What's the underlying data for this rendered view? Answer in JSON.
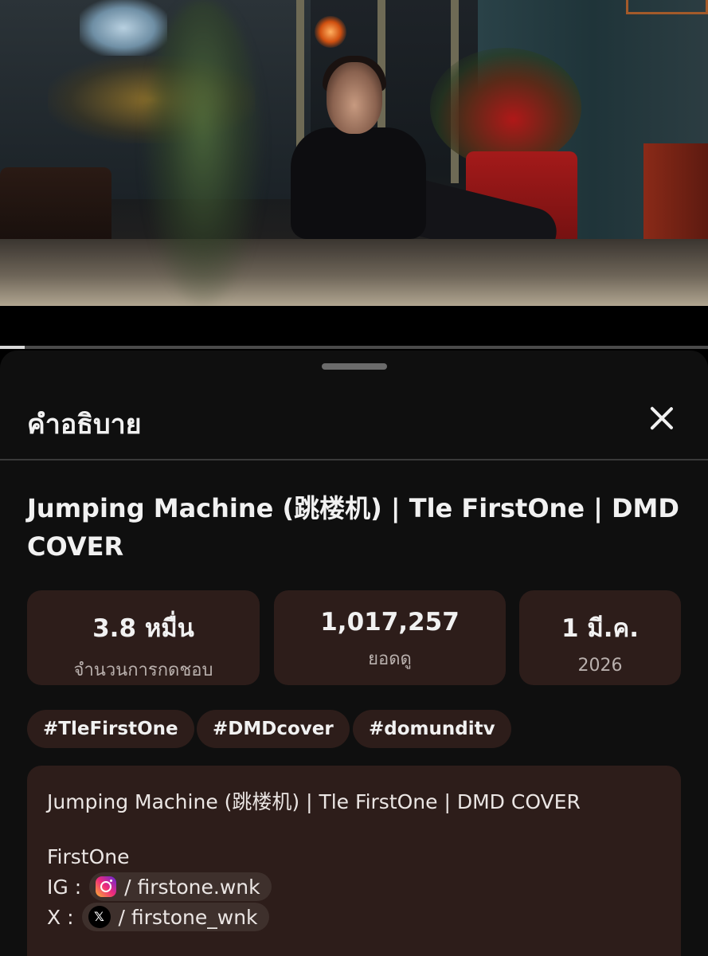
{
  "video": {
    "progress": 0.035
  },
  "sheet": {
    "title": "คำอธิบาย",
    "close_icon": "close-icon"
  },
  "video_title": "Jumping Machine (跳楼机) | Tle FirstOne | DMD COVER",
  "stats": {
    "likes_value": "3.8 หมื่น",
    "likes_label": "จำนวนการกดชอบ",
    "views_value": "1,017,257",
    "views_label": "ยอดดู",
    "date_value": "1 มี.ค.",
    "date_year": "2026"
  },
  "hashtags": [
    "#TleFirstOne",
    "#DMDcover",
    "#domunditv"
  ],
  "description": {
    "line1": "Jumping Machine (跳楼机) | Tle FirstOne | DMD COVER",
    "line2": "FirstOne",
    "ig_prefix": "IG :",
    "ig_handle": "/ firstone.wnk",
    "ig_icon": "instagram-icon",
    "x_prefix": "X :",
    "x_handle": "/ firstone_wnk",
    "x_icon": "x-icon",
    "x_glyph": "𝕏"
  },
  "colors": {
    "sheet_bg": "#0f0f0f",
    "card_bg": "#2d1d1a",
    "text": "#f1f1f1"
  }
}
